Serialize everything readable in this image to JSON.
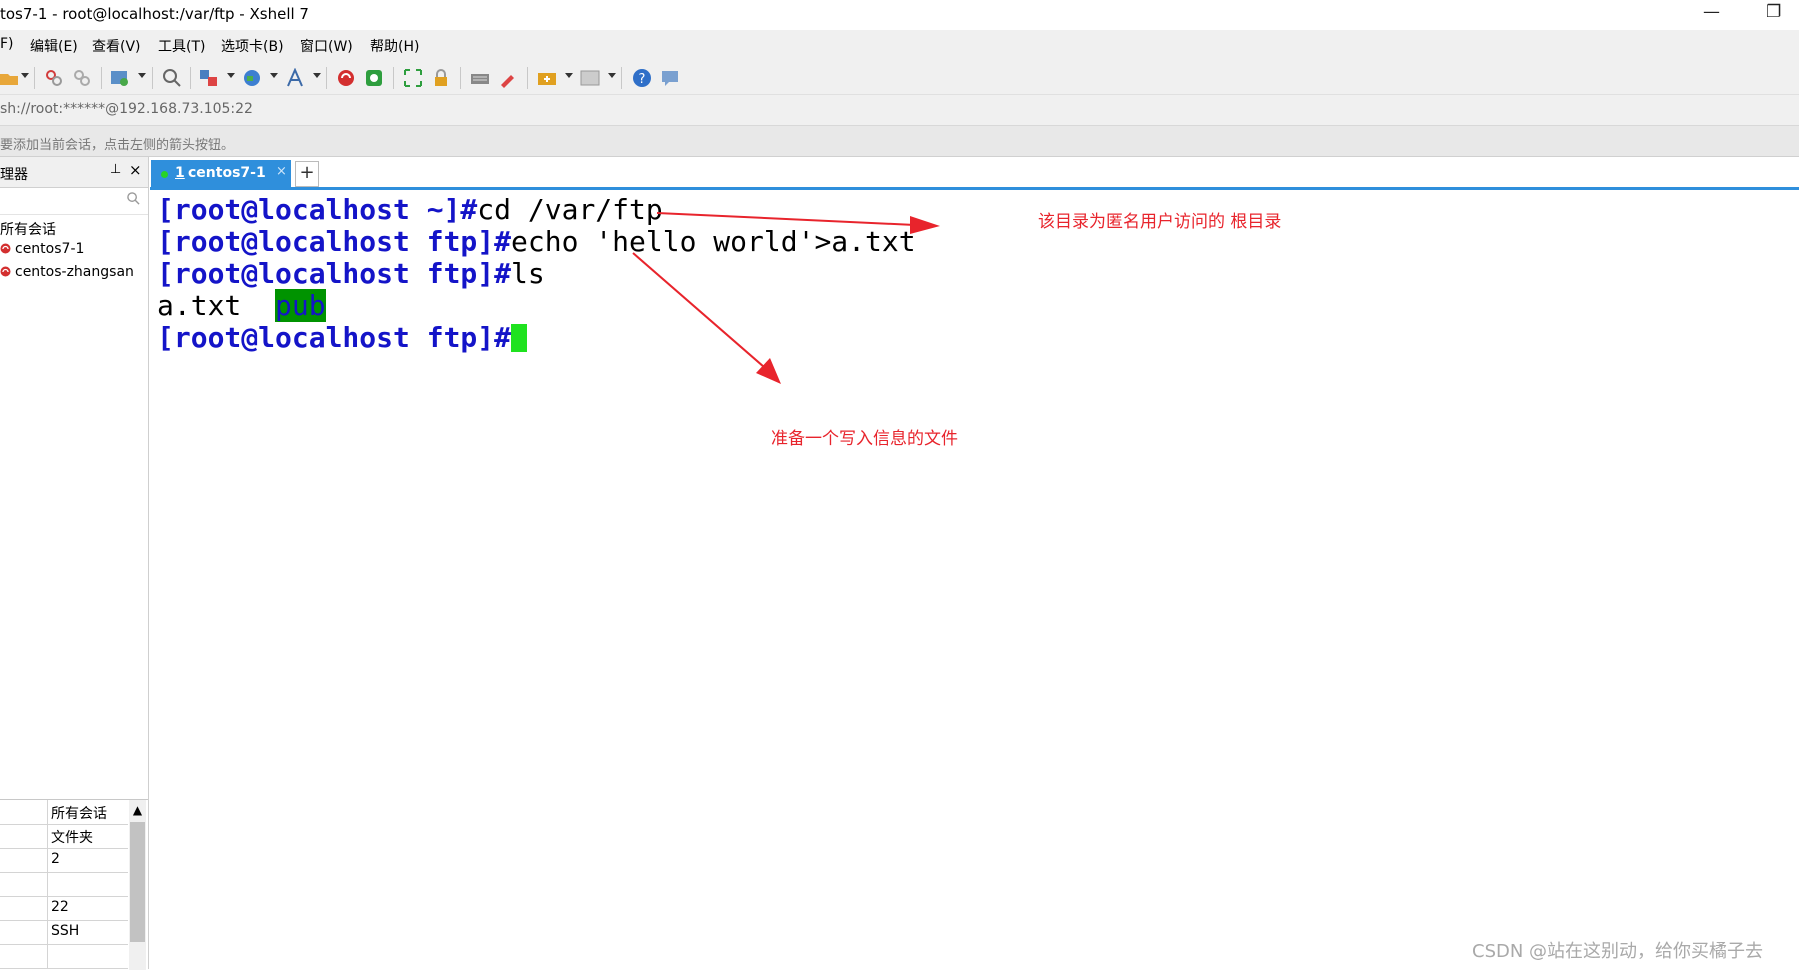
{
  "window": {
    "title": "tos7-1 - root@localhost:/var/ftp - Xshell 7",
    "minimize_glyph": "—",
    "restore_glyph": "❐"
  },
  "menu": {
    "items": [
      "F)",
      "编辑(E)",
      "查看(V)",
      "工具(T)",
      "选项卡(B)",
      "窗口(W)",
      "帮助(H)"
    ]
  },
  "toolbar": {
    "icons": [
      "open-folder-icon",
      "connect-icon",
      "disconnect-icon",
      "new-session-icon",
      "find-icon",
      "transfer-icon",
      "globe-icon",
      "font-icon",
      "xshell-icon",
      "xftp-icon",
      "fullscreen-icon",
      "lock-icon",
      "keyboard-icon",
      "highlight-icon",
      "add-tab-icon",
      "layout-icon",
      "help-icon",
      "chat-icon"
    ]
  },
  "address": {
    "text": "sh://root:******@192.168.73.105:22"
  },
  "hint": {
    "text": "要添加当前会话，点击左侧的箭头按钮。"
  },
  "sidebar": {
    "title": "理器",
    "pin_glyph": "⊥",
    "close_glyph": "×",
    "root_label": "所有会话",
    "sessions": [
      "centos7-1",
      "centos-zhangsan"
    ]
  },
  "properties": {
    "rows": [
      "所有会话",
      "文件夹",
      "2",
      "",
      "22",
      "SSH",
      ""
    ],
    "scroll_up_glyph": "▲"
  },
  "tabs": {
    "active": {
      "number": "1",
      "name": "centos7-1",
      "close_glyph": "×"
    },
    "add_glyph": "+"
  },
  "terminal": {
    "lines": [
      {
        "prompt": "[root@localhost ~]#",
        "command": "cd /var/ftp"
      },
      {
        "prompt": "[root@localhost ftp]#",
        "command": "echo 'hello world'>a.txt"
      },
      {
        "prompt": "[root@localhost ftp]#",
        "command": "ls"
      },
      {
        "output_file": "a.txt",
        "output_dir": "pub"
      },
      {
        "prompt": "[root@localhost ftp]#",
        "command": ""
      }
    ]
  },
  "annotations": {
    "root_dir_note": "该目录为匿名用户访问的 根目录",
    "file_note": "准备一个写入信息的文件"
  },
  "watermark": "CSDN @站在这别动，给你买橘子去",
  "colors": {
    "prompt": "#1414c8",
    "tab_active": "#2f8fdc",
    "cursor": "#1fe21f",
    "dir_highlight": "#009300",
    "annotation": "#e8242c"
  }
}
